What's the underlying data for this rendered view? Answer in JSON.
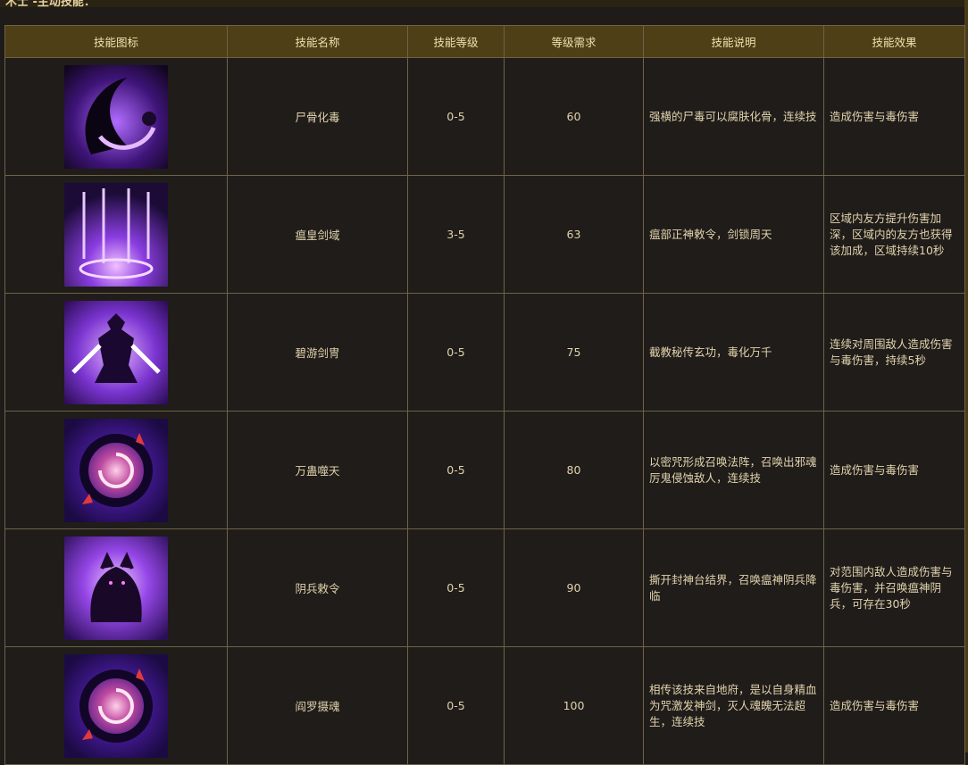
{
  "heading": "术士 -主动技能：",
  "columns": [
    "技能图标",
    "技能名称",
    "技能等级",
    "等级需求",
    "技能说明",
    "技能效果"
  ],
  "rows": [
    {
      "icon": "dark-crescent-skill-icon",
      "name": "尸骨化毒",
      "level": "0-5",
      "req": "60",
      "desc": "强横的尸毒可以腐肤化骨，连续技",
      "effect": "造成伤害与毒伤害"
    },
    {
      "icon": "sword-domain-skill-icon",
      "name": "瘟皇剑域",
      "level": "3-5",
      "req": "63",
      "desc": "瘟部正神敕令，剑锁周天",
      "effect": "区域内友方提升伤害加深，区域内的友方也获得该加成，区域持续10秒"
    },
    {
      "icon": "summoner-swords-skill-icon",
      "name": "碧游剑冑",
      "level": "0-5",
      "req": "75",
      "desc": "截教秘传玄功，毒化万千",
      "effect": "连续对周围敌人造成伤害与毒伤害，持续5秒"
    },
    {
      "icon": "swirl-portal-skill-icon",
      "name": "万蛊噬天",
      "level": "0-5",
      "req": "80",
      "desc": "以密咒形成召唤法阵，召唤出邪魂厉鬼侵蚀敌人，连续技",
      "effect": "造成伤害与毒伤害"
    },
    {
      "icon": "beast-summon-skill-icon",
      "name": "阴兵敕令",
      "level": "0-5",
      "req": "90",
      "desc": "撕开封神台结界，召唤瘟神阴兵降临",
      "effect": "对范围内敌人造成伤害与毒伤害，并召唤瘟神阴兵，可存在30秒"
    },
    {
      "icon": "swirl-portal-skill-icon",
      "name": "阎罗摄魂",
      "level": "0-5",
      "req": "100",
      "desc": "相传该技来自地府，是以自身精血为咒激发神剑，灭人魂魄无法超生，连续技",
      "effect": "造成伤害与毒伤害"
    }
  ],
  "colors": {
    "header_bg": "#4e3f16",
    "cell_bg": "#1f1c1a",
    "border": "#6f6246",
    "text": "#e2d3ac",
    "icon_purple": "#7b2fd6"
  }
}
